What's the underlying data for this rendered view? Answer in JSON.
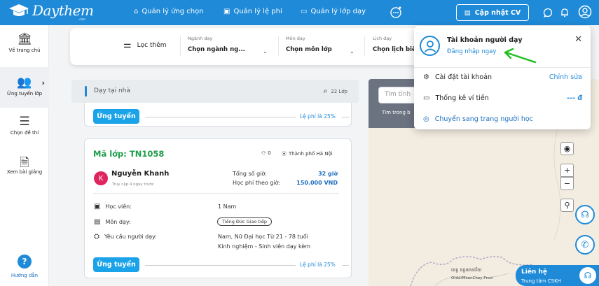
{
  "brand": {
    "name": "Daythem",
    "sub": ".com"
  },
  "nav": {
    "items": [
      {
        "label": "Quản lý ứng chọn",
        "icon": "tag-icon"
      },
      {
        "label": "Quản lý lệ phí",
        "icon": "receipt-icon"
      },
      {
        "label": "Quản lý lớp dạy",
        "icon": "chat-icon"
      }
    ],
    "cv_button": "Cập nhật CV"
  },
  "sidebar": {
    "items": [
      {
        "label": "Về trang chủ",
        "icon": "bank-icon"
      },
      {
        "label": "Ứng tuyển lớp",
        "icon": "group-icon"
      },
      {
        "label": "Chọn đề thi",
        "icon": "list-icon"
      },
      {
        "label": "Xem bài giảng",
        "icon": "document-icon"
      }
    ],
    "help": "Hướng dẫn"
  },
  "filters": {
    "toggle": "Lọc thêm",
    "groups": [
      {
        "label": "Ngành dạy",
        "value": "Chọn ngành ng..."
      },
      {
        "label": "Môn dạy",
        "value": "Chọn môn lớp"
      },
      {
        "label": "Lịch dạy",
        "value": "Chọn lịch biểu"
      }
    ]
  },
  "search": {
    "label": "Dạy tại nhà",
    "count": "22 Lớp"
  },
  "cards": {
    "first": {
      "apply": "Ứng tuyển",
      "fee": "Lệ phí là 25%"
    },
    "second": {
      "code": "Mã lớp: TN1058",
      "applicants": "0",
      "location": "Thành phố Hà Nội",
      "tutor_initial": "K",
      "tutor_name": "Nguyễn Khanh",
      "tutor_time": "Truy cập 4 ngày trước",
      "total_hours_label": "Tổng số giờ:",
      "total_hours": "32 giờ",
      "hourly_fee_label": "Học phí theo giờ:",
      "hourly_fee": "150.000 VND",
      "students_label": "Học viên:",
      "students": "1 Nam",
      "subject_label": "Môn dạy:",
      "subject": "Tiếng Đức Giao tiếp",
      "req_label": "Yêu cầu người dạy:",
      "req_line1": "Nam, Nữ    Đại học     Từ 21 - 78 tuổi",
      "req_line2": "Kinh nghiệm - Sinh viên dạy kèm",
      "apply": "Ứng tuyển",
      "fee": "Lệ phí là 25%"
    }
  },
  "map": {
    "search_placeholder": "Tìm tỉnh",
    "hint": "Tìm trong b",
    "labels": [
      "ខេត្ត ឧត្តរមានជ័យ",
      "OtdarMeanChey Provi"
    ]
  },
  "contact": {
    "title": "Liên hệ",
    "sub": "Trung tâm CSKH"
  },
  "popup": {
    "title": "Tài khoản người dạy",
    "login": "Đăng nhập ngay",
    "items": [
      {
        "label": "Cài đặt tài khoản",
        "right": "Chỉnh sửa",
        "icon": "gear-icon"
      },
      {
        "label": "Thống kê ví tiền",
        "right": "--- đ",
        "icon": "wallet-icon"
      },
      {
        "label": "Chuyển sang trang người học",
        "right": "",
        "icon": "user-circle-icon"
      }
    ]
  },
  "colors": {
    "primary": "#1e8ad8",
    "green": "#1e9c4a",
    "accent_button": "#1aa3e8",
    "avatar": "#e0245e"
  }
}
